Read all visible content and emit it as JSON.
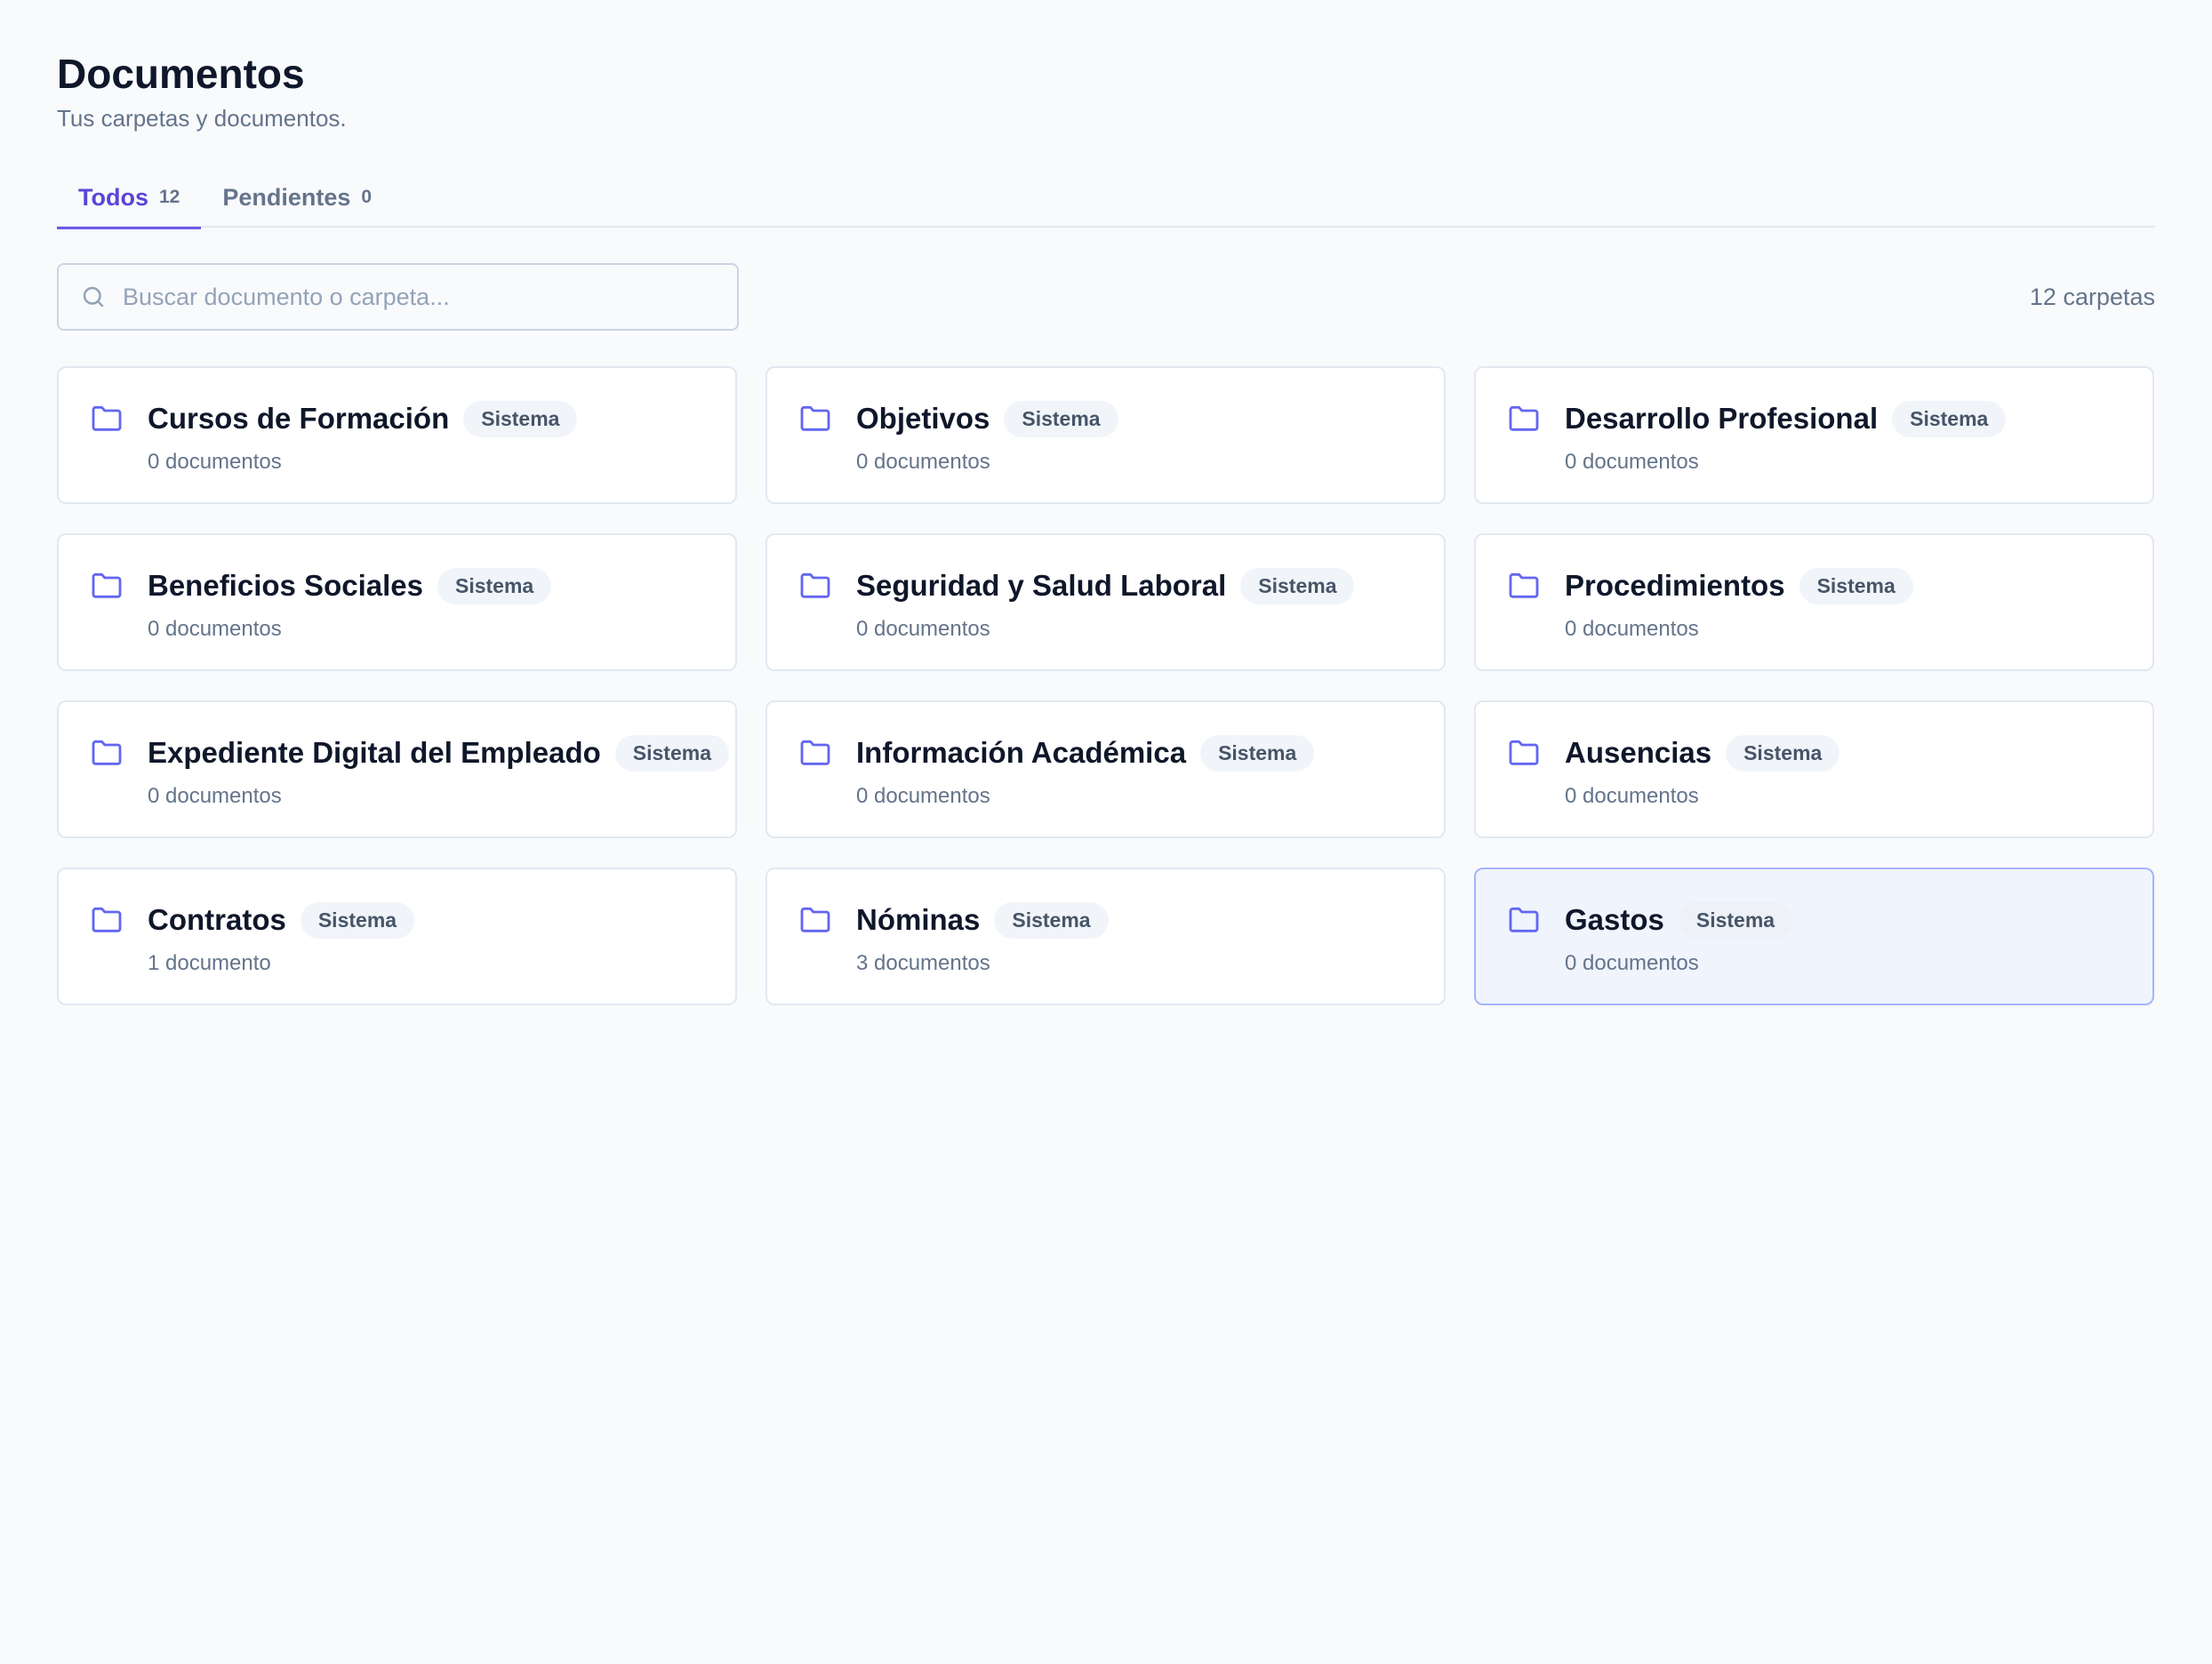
{
  "header": {
    "title": "Documentos",
    "subtitle": "Tus carpetas y documentos."
  },
  "tabs": [
    {
      "label": "Todos",
      "count": "12",
      "active": true
    },
    {
      "label": "Pendientes",
      "count": "0",
      "active": false
    }
  ],
  "search": {
    "placeholder": "Buscar documento o carpeta...",
    "value": ""
  },
  "folder_count": "12 carpetas",
  "colors": {
    "accent": "#5b45d6",
    "folder_icon": "#6366f1",
    "highlight_bg": "#eff4fd"
  },
  "folders": [
    {
      "name": "Cursos de Formación",
      "badge": "Sistema",
      "docs": "0 documentos",
      "icon": "folder-icon"
    },
    {
      "name": "Objetivos",
      "badge": "Sistema",
      "docs": "0 documentos",
      "icon": "folder-icon"
    },
    {
      "name": "Desarrollo Profesional",
      "badge": "Sistema",
      "docs": "0 documentos",
      "icon": "folder-icon"
    },
    {
      "name": "Beneficios Sociales",
      "badge": "Sistema",
      "docs": "0 documentos",
      "icon": "folder-icon"
    },
    {
      "name": "Seguridad y Salud Laboral",
      "badge": "Sistema",
      "docs": "0 documentos",
      "icon": "folder-icon"
    },
    {
      "name": "Procedimientos",
      "badge": "Sistema",
      "docs": "0 documentos",
      "icon": "folder-icon"
    },
    {
      "name": "Expediente Digital del Empleado",
      "badge": "Sistema",
      "docs": "0 documentos",
      "icon": "folder-icon"
    },
    {
      "name": "Información Académica",
      "badge": "Sistema",
      "docs": "0 documentos",
      "icon": "folder-icon"
    },
    {
      "name": "Ausencias",
      "badge": "Sistema",
      "docs": "0 documentos",
      "icon": "folder-icon"
    },
    {
      "name": "Contratos",
      "badge": "Sistema",
      "docs": "1 documento",
      "icon": "folder-icon"
    },
    {
      "name": "Nóminas",
      "badge": "Sistema",
      "docs": "3 documentos",
      "icon": "folder-icon"
    },
    {
      "name": "Gastos",
      "badge": "Sistema",
      "docs": "0 documentos",
      "icon": "folder-icon",
      "highlighted": true
    }
  ]
}
